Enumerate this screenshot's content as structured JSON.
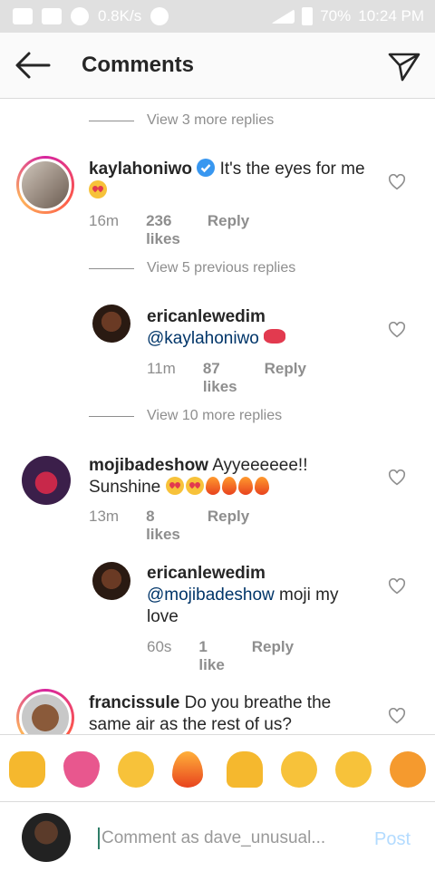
{
  "status_bar": {
    "network_speed": "0.8K/s",
    "battery": "70%",
    "time": "10:24 PM"
  },
  "header": {
    "title": "Comments"
  },
  "thread": {
    "view_more_1": "View 3 more replies",
    "c1": {
      "username": "kaylahoniwo",
      "text": "It's the eyes for me",
      "time": "16m",
      "likes": "236 likes",
      "reply": "Reply"
    },
    "view_prev_2": "View 5 previous replies",
    "r1": {
      "username": "ericanlewedim",
      "mention": "@kaylahoniwo",
      "time": "11m",
      "likes": "87 likes",
      "reply": "Reply"
    },
    "view_more_3": "View 10 more replies",
    "c2": {
      "username": "mojibadeshow",
      "text_line1": "Ayyeeeeee!!",
      "text_line2": "Sunshine",
      "time": "13m",
      "likes": "8 likes",
      "reply": "Reply"
    },
    "r2": {
      "username": "ericanlewedim",
      "mention": "@mojibadeshow",
      "text": "moji my love",
      "time": "60s",
      "likes": "1 like",
      "reply": "Reply"
    },
    "c3": {
      "username": "francissule",
      "text": "Do you breathe the same air as the rest of us?"
    }
  },
  "emoji_bar": [
    "clapping-hands",
    "sparkling-heart",
    "grinning-squinting-face",
    "fire",
    "folded-hands",
    "face-blowing-kiss",
    "beaming-face",
    "weary-face"
  ],
  "composer": {
    "placeholder": "Comment as dave_unusual...",
    "post_label": "Post"
  },
  "colors": {
    "link": "#003569",
    "muted": "#8e8e8e",
    "post_disabled": "#b3dbff",
    "verified": "#3897f0"
  }
}
